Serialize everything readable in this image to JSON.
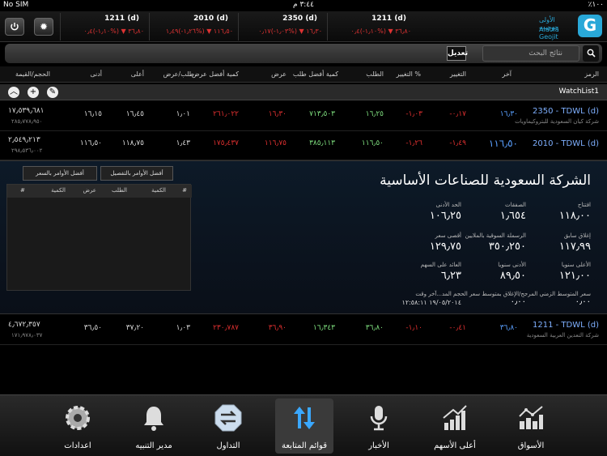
{
  "status": {
    "carrier": "No SIM",
    "time": "٣:٤٤ م",
    "battery": "٪١٠٠"
  },
  "tickers": [
    {
      "name": "1211 (d)",
      "value": "٣٦٫٨٠  ▼ (%١٫١٠-)٠٫٤"
    },
    {
      "name": "2010 (d)",
      "value": "١١٦٫٥٠  ▼ (%١٫٢٦-)١٫٤٩"
    },
    {
      "name": "2350 (d)",
      "value": "١٦٫٣٠  ▼ (%١٫٠٣-)٠٫١٧"
    },
    {
      "name": "1211 (d)",
      "value": "٣٦٫٨٠  ▼ (%١٫١٠-)٠٫٤"
    }
  ],
  "logo": {
    "line1": "الأولى جوجيت",
    "line2": "Alaola Geojit"
  },
  "search": {
    "placeholder": "نتائج البحث",
    "edit_label": "تعديل"
  },
  "headers": {
    "symbol": "الرمز",
    "last": "آخر",
    "change": "التغيير",
    "change_pct": "التغيير %",
    "bid": "الطلب",
    "best_bid_qty": "كمية أفضل طلب",
    "ask": "عرض",
    "best_ask_qty": "كمية أفضل عرض",
    "bid_ask": "طلب/عرض",
    "high": "أعلى",
    "low": "أدنى",
    "volume_value": "الحجم/القيمة"
  },
  "watchlist": {
    "title": "WatchList1"
  },
  "rows": [
    {
      "symbol": "2350 - TDWL (d)",
      "name": "شركة كيان السعودية للبتروكيماويات",
      "last": "١٦٫٣٠",
      "change": "-٠٫١٧",
      "change_pct": "-١٫٠٣",
      "bid": "١٦٫٢٥",
      "bid_qty": "٧١٣٫٥٠٣",
      "ask": "١٦٫٣٠",
      "ask_qty": "٢٦١٫٠٢٢",
      "ratio": "١٫٠١",
      "high": "١٦٫٤٥",
      "low": "١٦٫١٥",
      "volume": "١٧٫٥٣٩٫٦٨١",
      "value": "٢٨٥٫٧٧٨٫٩٥٠"
    },
    {
      "symbol": "2010 - TDWL (d)",
      "name": "",
      "last": "١١٦٫٥٠",
      "change": "-١٫٤٩",
      "change_pct": "-١٫٢٦",
      "bid": "١١٦٫٥٠",
      "bid_qty": "٣٨٥٫١١٣",
      "ask": "١١٦٫٧٥",
      "ask_qty": "١٧٥٫٤٣٧",
      "ratio": "١٫٤٣",
      "high": "١١٨٫٧٥",
      "low": "١١٦٫٥٠",
      "volume": "٢٫٥٤٩٫٢١٣",
      "value": "٢٩٨٫٥٣٦٫٠٠٢"
    },
    {
      "symbol": "1211 - TDWL (d)",
      "name": "شركة التعدين العربية السعودية",
      "last": "٣٦٫٨٠",
      "change": "-٠٫٤١",
      "change_pct": "-١٫١٠",
      "bid": "٣٦٫٨٠",
      "bid_qty": "١٦٫٣٤٣",
      "ask": "٣٦٫٩٠",
      "ask_qty": "٢٣٠٫٧٨٧",
      "ratio": "١٫٠٣",
      "high": "٣٧٫٢٠",
      "low": "٣٦٫٥٠",
      "volume": "٤٫٦٧٢٫٣٥٧",
      "value": "١٧١٫٩٧٨٫٠٣٧"
    }
  ],
  "detail": {
    "title": "الشركة السعودية للصناعات الأساسية",
    "tab_detail": "أفضل الأوامر بالتفصيل",
    "tab_price": "أفضل الأوامر بالسعر",
    "ob_headers": {
      "hash": "#",
      "qty": "الكمية",
      "bid": "الطلب",
      "ask": "عرض",
      "qty2": "الكمية",
      "hash2": "#"
    },
    "open_lbl": "افتتاح",
    "open_val": "١١٨٫٠٠",
    "trades_lbl": "الصفقات",
    "trades_val": "١٫٦٥٤",
    "minlimit_lbl": "الحد الأدنى",
    "minlimit_val": "١٠٦٫٢٥",
    "prevclose_lbl": "إغلاق سابق",
    "prevclose_val": "١١٧٫٩٩",
    "mcap_lbl": "الرسملة السوقية بالملايين",
    "mcap_val": "٣٥٠٫٢٥٠",
    "maxprice_lbl": "أقصى سعر",
    "maxprice_val": "١٢٩٫٧٥",
    "yhigh_lbl": "الأعلى سنويا",
    "yhigh_val": "١٢١٫٠٠",
    "ylow_lbl": "الأدنى سنويا",
    "ylow_val": "٨٩٫٥٠",
    "eps_lbl": "العائد على السهم",
    "eps_val": "٦٫٢٣",
    "note": "سعر المتوسط الزمني المرجح/الإغلاق بمتوسط سعر الحجم المد...آخر وقت",
    "vwap1": "٠٫٠٠",
    "vwap2": "٠٫٠٠",
    "last_time": "١٩/٠٥/٢٠١٤ ١٢:٥٨:١١"
  },
  "tabs": [
    {
      "label": "اعدادات"
    },
    {
      "label": "مدير التنبيه"
    },
    {
      "label": "التداول"
    },
    {
      "label": "قوائم المتابعة"
    },
    {
      "label": "الأخبار"
    },
    {
      "label": "أعلى الأسهم"
    },
    {
      "label": "الأسواق"
    }
  ],
  "colors": {
    "up": "#7fe07f",
    "down": "#e03030",
    "accent": "#29a8d8",
    "last": "#5aa0ff"
  }
}
